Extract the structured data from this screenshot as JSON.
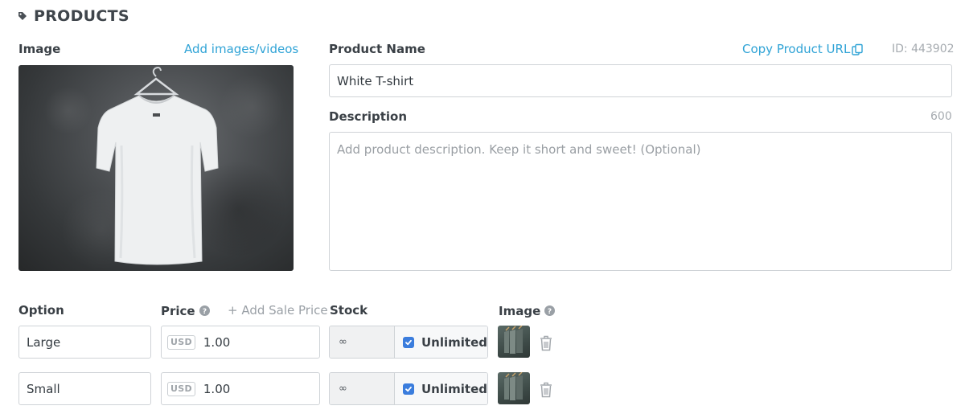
{
  "header": {
    "title": "PRODUCTS",
    "icon": "tag-icon"
  },
  "image_section": {
    "label": "Image",
    "add_link": "Add images/videos"
  },
  "product": {
    "name_label": "Product Name",
    "name_value": "White T-shirt",
    "copy_url_label": "Copy Product URL",
    "id_text": "ID: 443902",
    "description_label": "Description",
    "description_limit": "600",
    "description_placeholder": "Add product description. Keep it short and sweet! (Optional)",
    "description_value": ""
  },
  "variants": {
    "headers": {
      "option": "Option",
      "price": "Price",
      "add_sale_price": "+ Add Sale Price",
      "stock": "Stock",
      "image": "Image"
    },
    "rows": [
      {
        "option": "Large",
        "currency": "USD",
        "price": "1.00",
        "stock": "∞",
        "unlimited_label": "Unlimited",
        "unlimited": true
      },
      {
        "option": "Small",
        "currency": "USD",
        "price": "1.00",
        "stock": "∞",
        "unlimited_label": "Unlimited",
        "unlimited": true
      }
    ]
  },
  "colors": {
    "link": "#2fa3d6",
    "checkbox": "#3b7ddd",
    "border": "#cfd3d7"
  }
}
